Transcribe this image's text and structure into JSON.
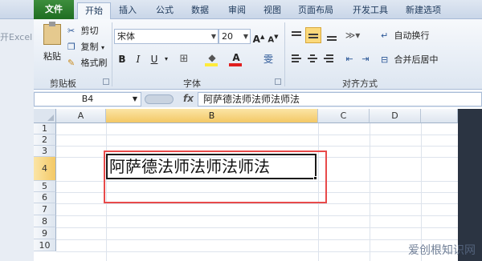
{
  "app": {
    "left_ghost_text": "开Excel"
  },
  "tabs": {
    "file": "文件",
    "home": "开始",
    "insert": "插入",
    "formulas": "公式",
    "data": "数据",
    "review": "审阅",
    "view": "视图",
    "page_layout": "页面布局",
    "developer": "开发工具",
    "new_tab": "新建选项"
  },
  "clipboard": {
    "paste": "粘贴",
    "cut": "剪切",
    "copy": "复制",
    "format_painter": "格式刷",
    "caption": "剪贴板"
  },
  "font": {
    "name": "宋体",
    "size": "20",
    "bold": "B",
    "italic": "I",
    "underline": "U",
    "caption": "字体",
    "phonetic": "雯"
  },
  "alignment": {
    "wrap_text": "自动换行",
    "merge_center": "合并后居中",
    "caption": "对齐方式"
  },
  "formula_bar": {
    "name_box": "B4",
    "fx": "fx",
    "content": "阿萨德法师法师法师法"
  },
  "grid": {
    "columns": [
      "A",
      "B",
      "C",
      "D"
    ],
    "rows": [
      "1",
      "2",
      "3",
      "4",
      "5",
      "6",
      "7",
      "8",
      "9",
      "10"
    ],
    "active_cell": "B4",
    "active_value": "阿萨德法师法师法师法"
  },
  "colors": {
    "selection_highlight": "#e84a4a",
    "file_tab": "#2b7a2e",
    "header_selected": "#f5cf73"
  },
  "watermark": "爱创根知识网"
}
